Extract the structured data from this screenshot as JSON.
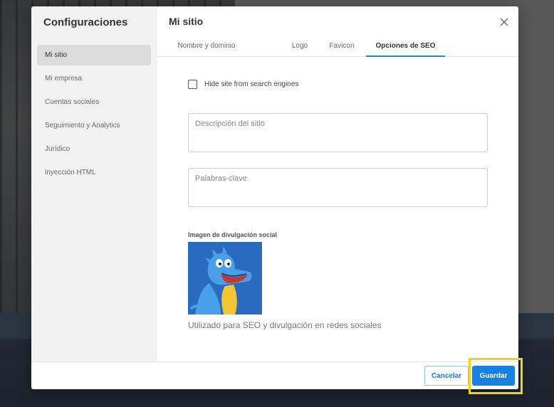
{
  "sidebar": {
    "title": "Configuraciones",
    "items": [
      {
        "label": "Mi sitio",
        "active": true
      },
      {
        "label": "Mi empresa",
        "active": false
      },
      {
        "label": "Cuentas sociales",
        "active": false
      },
      {
        "label": "Seguimiento y Analytics",
        "active": false
      },
      {
        "label": "Jurídico",
        "active": false
      },
      {
        "label": "inyección HTML",
        "active": false
      }
    ]
  },
  "main": {
    "title": "Mi sitio",
    "tabs": [
      {
        "label": "Nombre y dominio",
        "active": false
      },
      {
        "label": "Logo",
        "active": false
      },
      {
        "label": "Favicon",
        "active": false
      },
      {
        "label": "Opciones de SEO",
        "active": true
      }
    ],
    "hide_checkbox": {
      "label": "Hide site from search engines",
      "checked": false
    },
    "description_field": {
      "placeholder": "Descripción del sitio",
      "value": ""
    },
    "keywords_field": {
      "placeholder": "Palabras-clave",
      "value": ""
    },
    "social_image": {
      "label": "Imagen de divulgación social",
      "help": "Utilizado para SEO y divulgación en redes sociales"
    }
  },
  "footer": {
    "cancel_label": "Cancelar",
    "save_label": "Guardar"
  },
  "colors": {
    "accent": "#1582e0",
    "highlight": "#f2d11b"
  }
}
